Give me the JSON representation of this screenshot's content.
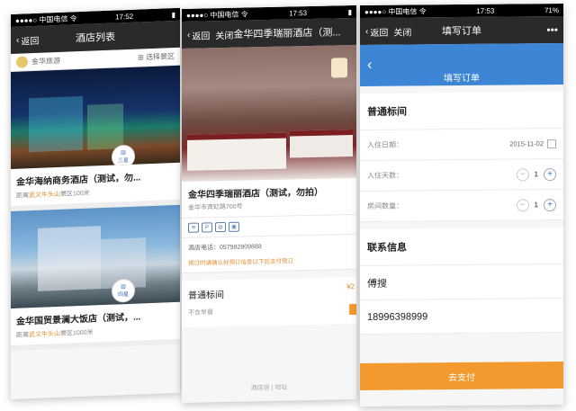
{
  "phone1": {
    "status": {
      "carrier": "●●●●○ 中国电信 令",
      "time": "17:52"
    },
    "nav": {
      "back_label": "返回",
      "title": "酒店列表"
    },
    "sub": {
      "brand": "金华旅游",
      "filter": "选择景区"
    },
    "hotels": [
      {
        "badge": "三星",
        "name": "金华海纳商务酒店（测试，勿...",
        "meta_prefix": "距离",
        "meta_place": "武义牛头山",
        "meta_suffix": "景区100米"
      },
      {
        "badge": "四星",
        "name": "金华国贸景澜大饭店（测试，...",
        "meta_prefix": "距离",
        "meta_place": "武义牛头山",
        "meta_suffix": "景区1000米"
      }
    ],
    "price_mark": "¥"
  },
  "phone2": {
    "status": {
      "carrier": "●●●●○ 中国电信 令",
      "time": "17:53"
    },
    "nav": {
      "back_label": "返回",
      "close_label": "关闭",
      "title": "金华四季瑞丽酒店（测..."
    },
    "hotel_name": "金华四季瑞丽酒店（测试，勿拍）",
    "address": "金华市宾虹路700号",
    "amenities": [
      "wifi",
      "P",
      "餐",
      "车"
    ],
    "phone_label": "酒店电话：057982809888",
    "notice": "预订时请确认好预订信息以下后支付预订",
    "room": {
      "name": "普通标间",
      "desc": "不含早餐",
      "price": "¥2"
    },
    "footer": "酒店信 | 地址"
  },
  "phone3": {
    "status": {
      "carrier": "●●●●○ 中国电信 令",
      "time": "17:53",
      "battery": "71%"
    },
    "nav": {
      "back_label": "返回",
      "close_label": "关闭",
      "title": "填写订单",
      "more": "•••"
    },
    "header_title": "填写订单",
    "room_type": "普通标间",
    "checkin_label": "入住日期：",
    "checkin_value": "2015-11-02",
    "days_label": "入住天数：",
    "days_value": "1",
    "rooms_label": "房间数量：",
    "rooms_value": "1",
    "contact_title": "联系信息",
    "contact_name": "傅搜",
    "contact_phone": "18996398999",
    "pay_label": "去支付"
  }
}
